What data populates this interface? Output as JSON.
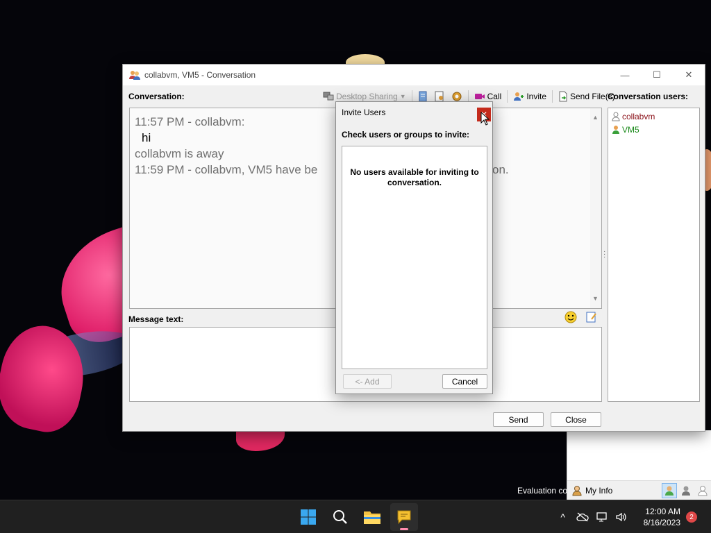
{
  "window": {
    "title": "collabvm, VM5 - Conversation",
    "controls": {
      "minimize": "—",
      "maximize": "☐",
      "close": "✕"
    }
  },
  "conversation": {
    "label": "Conversation:",
    "messages": [
      "11:57 PM - collabvm:",
      "hi",
      "collabvm is away",
      "11:59 PM - collabvm, VM5 have be",
      "on."
    ]
  },
  "toolbar": {
    "desktop_sharing": "Desktop Sharing",
    "call": "Call",
    "invite": "Invite",
    "send_files": "Send File(s)"
  },
  "message": {
    "label": "Message text:",
    "value": ""
  },
  "users": {
    "label": "Conversation users:",
    "items": [
      {
        "name": "collabvm"
      },
      {
        "name": "VM5"
      }
    ]
  },
  "buttons": {
    "send": "Send",
    "close": "Close"
  },
  "invite_dialog": {
    "title": "Invite Users",
    "close": "✕",
    "instruction": "Check users or groups to invite:",
    "empty_message": "No users available for inviting to conversation.",
    "add_button": "<- Add",
    "cancel_button": "Cancel"
  },
  "buddy_list": {
    "my_info": "My Info"
  },
  "desktop": {
    "evaluation_text": "Evaluation co"
  },
  "taskbar": {
    "time": "12:00 AM",
    "date": "8/16/2023",
    "notification_count": "2",
    "tray_chevron": "^"
  },
  "colors": {
    "self_user": "#8a1018",
    "buddy_user": "#1a8a1a",
    "close_red": "#c42b1c",
    "taskbar_bg": "#202020"
  }
}
